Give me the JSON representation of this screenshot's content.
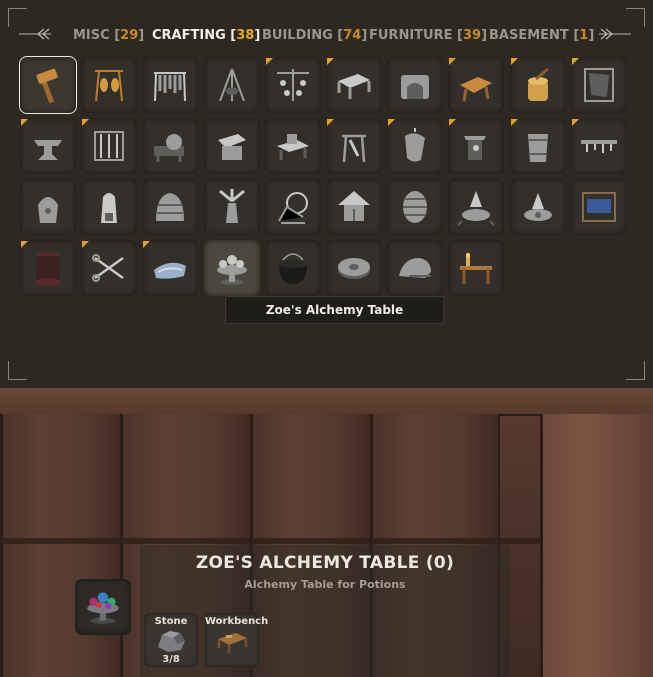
{
  "tabs": [
    {
      "label": "MISC",
      "count": "29",
      "active": false
    },
    {
      "label": "CRAFTING",
      "count": "38",
      "active": true
    },
    {
      "label": "BUILDING",
      "count": "74",
      "active": false
    },
    {
      "label": "FURNITURE",
      "count": "39",
      "active": false
    },
    {
      "label": "BASEMENT",
      "count": "1",
      "active": false
    }
  ],
  "grid_items": [
    {
      "icon": "hammer-icon",
      "selected": true,
      "new": false
    },
    {
      "icon": "training-dummy-icon",
      "new": false
    },
    {
      "icon": "tool-rack-icon",
      "new": false
    },
    {
      "icon": "cooking-tripod-icon",
      "new": false
    },
    {
      "icon": "hanging-rack-icon",
      "new": true
    },
    {
      "icon": "workbench-upgrade-icon",
      "new": true
    },
    {
      "icon": "stone-oven-icon",
      "new": false
    },
    {
      "icon": "tanning-rack-icon",
      "new": true
    },
    {
      "icon": "chopping-block-icon",
      "new": true
    },
    {
      "icon": "hide-rack-icon",
      "new": true
    },
    {
      "icon": "anvil-icon",
      "new": true
    },
    {
      "icon": "weapon-rack-icon",
      "new": true
    },
    {
      "icon": "grinding-wheel-icon",
      "new": false
    },
    {
      "icon": "forge-cooler-icon",
      "new": false
    },
    {
      "icon": "vise-icon",
      "new": false
    },
    {
      "icon": "tool-stand-icon",
      "new": true
    },
    {
      "icon": "bellows-icon",
      "new": true
    },
    {
      "icon": "blackforge-anvil-icon",
      "new": true
    },
    {
      "icon": "bucket-icon",
      "new": true
    },
    {
      "icon": "tool-shelf-icon",
      "new": true
    },
    {
      "icon": "smelter-icon",
      "new": false
    },
    {
      "icon": "blast-furnace-icon",
      "new": false
    },
    {
      "icon": "charcoal-kiln-icon",
      "new": false
    },
    {
      "icon": "windmill-icon",
      "new": false
    },
    {
      "icon": "spinning-wheel-icon",
      "new": false
    },
    {
      "icon": "beehive-icon",
      "new": false
    },
    {
      "icon": "barrel-icon",
      "new": false
    },
    {
      "icon": "eitr-refinery-icon",
      "new": false
    },
    {
      "icon": "galdr-table-icon",
      "new": false
    },
    {
      "icon": "loom-icon",
      "new": false
    },
    {
      "icon": "yarn-spool-icon",
      "new": true
    },
    {
      "icon": "shears-icon",
      "new": true
    },
    {
      "icon": "fabric-roll-icon",
      "new": true
    },
    {
      "icon": "alchemy-table-icon",
      "new": false,
      "hover": true
    },
    {
      "icon": "cauldron-icon",
      "new": false
    },
    {
      "icon": "millstone-icon",
      "new": false
    },
    {
      "icon": "whetstone-icon",
      "new": false
    },
    {
      "icon": "writing-desk-icon",
      "new": false
    }
  ],
  "tooltip": "Zoe's Alchemy Table",
  "selected_piece": {
    "title": "ZOE'S ALCHEMY TABLE (0)",
    "description": "Alchemy Table for Potions",
    "icon": "alchemy-table-icon"
  },
  "requirements": [
    {
      "name": "Stone",
      "amount": "3/8",
      "icon": "stone-icon"
    },
    {
      "name": "Workbench",
      "amount": "",
      "icon": "workbench-icon"
    }
  ],
  "colors": {
    "accent": "#e7a72a",
    "new_marker": "#e3a321",
    "panel_bg": "#2c2822"
  }
}
